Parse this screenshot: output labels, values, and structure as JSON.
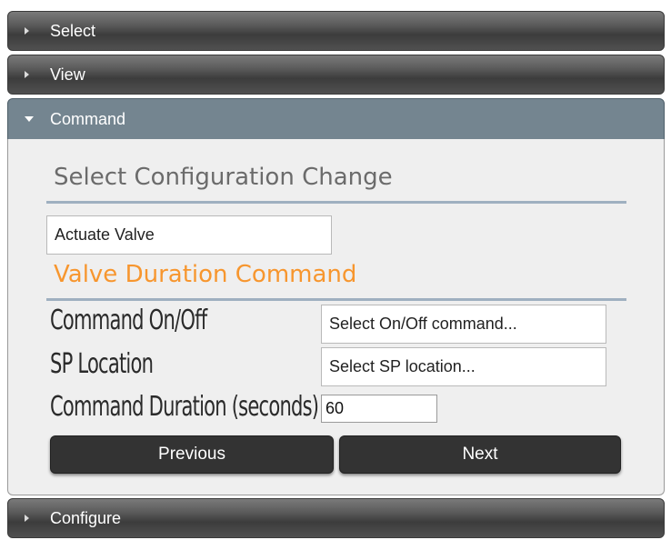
{
  "accordion": {
    "select": {
      "label": "Select",
      "icon": "triangle-right-icon"
    },
    "view": {
      "label": "View",
      "icon": "triangle-right-icon"
    },
    "command": {
      "label": "Command",
      "icon": "triangle-down-icon"
    },
    "configure": {
      "label": "Configure",
      "icon": "triangle-right-icon"
    }
  },
  "command_panel": {
    "config_change_title": "Select Configuration Change",
    "config_change_value": "Actuate Valve",
    "valve_title": "Valve Duration Command",
    "fields": {
      "on_off": {
        "label": "Command On/Off",
        "value": "Select On/Off command..."
      },
      "sp_location": {
        "label": "SP Location",
        "value": "Select SP location..."
      },
      "duration": {
        "label": "Command Duration (seconds)",
        "value": "60"
      }
    },
    "buttons": {
      "previous": "Previous",
      "next": "Next"
    }
  },
  "colors": {
    "header_gradient_top": "#7a7a7a",
    "header_gradient_bottom": "#3c3c3c",
    "active_header": "#748590",
    "panel_bg": "#efefef",
    "title_rule": "#9fb0c0",
    "title_gray": "#6b6b6b",
    "title_orange": "#f7962e",
    "button_bg": "#333333"
  }
}
